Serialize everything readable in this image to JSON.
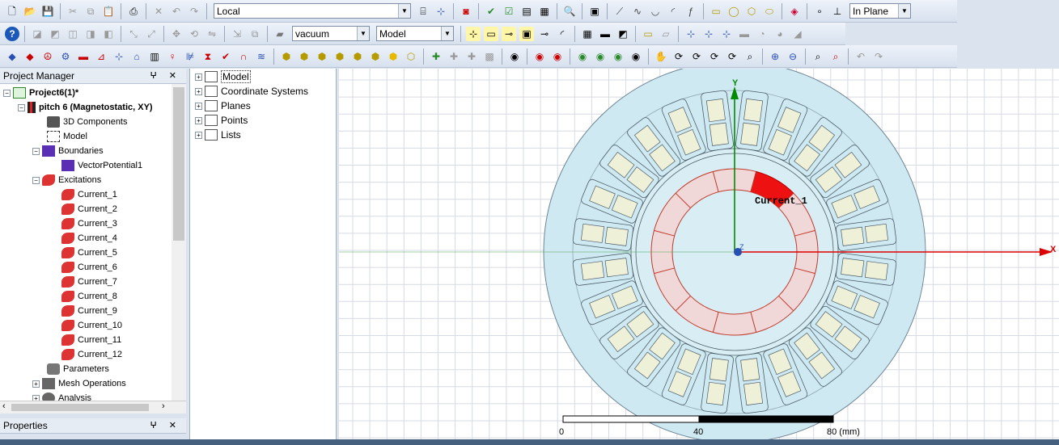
{
  "toolbar": {
    "coord_system": "Local",
    "material": "vacuum",
    "layer": "Model",
    "plane_mode": "In Plane"
  },
  "project_manager": {
    "title": "Project Manager",
    "controls": "1 ✕",
    "project": "Project6(1)*",
    "design": "pitch  6 (Magnetostatic, XY)",
    "items": {
      "components": "3D Components",
      "model": "Model",
      "boundaries": "Boundaries",
      "vector_potential": "VectorPotential1",
      "excitations": "Excitations",
      "currents": [
        "Current_1",
        "Current_2",
        "Current_3",
        "Current_4",
        "Current_5",
        "Current_6",
        "Current_7",
        "Current_8",
        "Current_9",
        "Current_10",
        "Current_11",
        "Current_12"
      ],
      "parameters": "Parameters",
      "mesh": "Mesh Operations",
      "analysis": "Analysis"
    }
  },
  "properties": {
    "title": "Properties"
  },
  "model_tree": [
    "Model",
    "Coordinate Systems",
    "Planes",
    "Points",
    "Lists"
  ],
  "viewport": {
    "highlight_label": "Current_1",
    "axis_x": "X",
    "axis_y": "Y",
    "axis_z": "Z",
    "scale_labels": [
      "0",
      "40",
      "80 (mm)"
    ]
  },
  "colors": {
    "stator": "#cfe9f2",
    "slot": "#eef0d8",
    "highlight": "#ee1111",
    "axis_x": "#dd0000",
    "axis_y": "#008a00"
  }
}
